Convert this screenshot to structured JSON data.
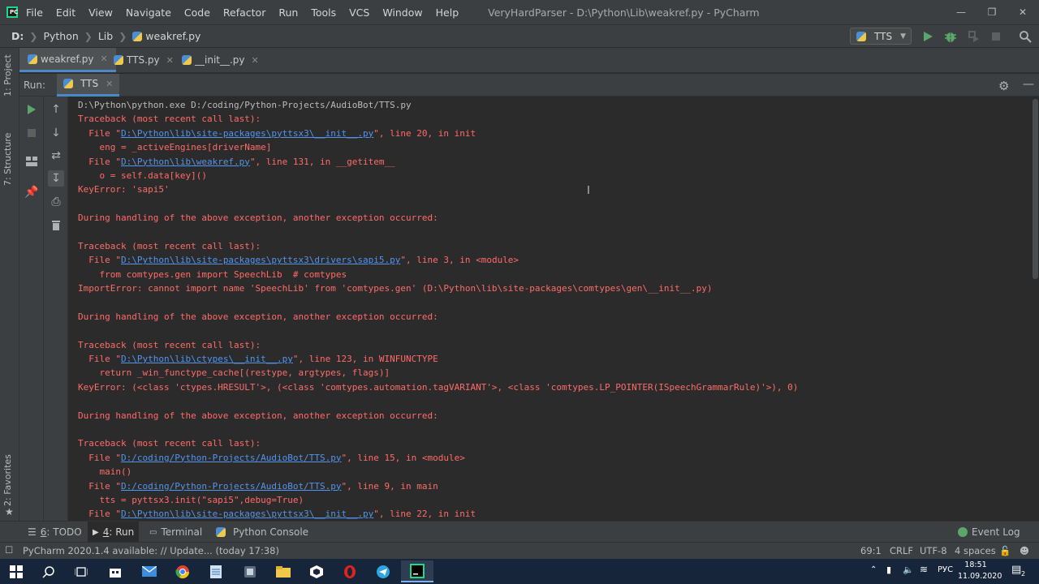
{
  "window": {
    "title": "VeryHardParser - D:\\Python\\Lib\\weakref.py - PyCharm",
    "logo_text": "PC",
    "menu": [
      "File",
      "Edit",
      "View",
      "Navigate",
      "Code",
      "Refactor",
      "Run",
      "Tools",
      "VCS",
      "Window",
      "Help"
    ]
  },
  "breadcrumb": [
    "D:",
    "Python",
    "Lib",
    "weakref.py"
  ],
  "run_config": {
    "name": "TTS"
  },
  "editor_tabs": [
    {
      "label": "weakref.py",
      "active": true
    },
    {
      "label": "TTS.py",
      "active": false
    },
    {
      "label": "__init__.py",
      "active": false
    }
  ],
  "left_stripe": {
    "project": "1: Project",
    "structure": "7: Structure",
    "favorites": "2: Favorites"
  },
  "run_panel": {
    "label": "Run:",
    "tab": "TTS"
  },
  "console": {
    "lines": [
      {
        "type": "cmd",
        "parts": [
          {
            "t": "D:\\Python\\python.exe D:/coding/Python-Projects/AudioBot/TTS.py"
          }
        ]
      },
      {
        "type": "err",
        "parts": [
          {
            "t": "Traceback (most recent call last):"
          }
        ]
      },
      {
        "type": "err",
        "parts": [
          {
            "t": "  File \""
          },
          {
            "t": "D:\\Python\\lib\\site-packages\\pyttsx3\\__init__.py",
            "link": true
          },
          {
            "t": "\", line 20, in init"
          }
        ]
      },
      {
        "type": "err",
        "parts": [
          {
            "t": "    eng = _activeEngines[driverName]"
          }
        ]
      },
      {
        "type": "err",
        "parts": [
          {
            "t": "  File \""
          },
          {
            "t": "D:\\Python\\lib\\weakref.py",
            "link": true
          },
          {
            "t": "\", line 131, in __getitem__"
          }
        ]
      },
      {
        "type": "err",
        "parts": [
          {
            "t": "    o = self.data[key]()"
          }
        ]
      },
      {
        "type": "err",
        "parts": [
          {
            "t": "KeyError: 'sapi5'"
          }
        ]
      },
      {
        "type": "err",
        "parts": [
          {
            "t": ""
          }
        ]
      },
      {
        "type": "err",
        "parts": [
          {
            "t": "During handling of the above exception, another exception occurred:"
          }
        ]
      },
      {
        "type": "err",
        "parts": [
          {
            "t": ""
          }
        ]
      },
      {
        "type": "err",
        "parts": [
          {
            "t": "Traceback (most recent call last):"
          }
        ]
      },
      {
        "type": "err",
        "parts": [
          {
            "t": "  File \""
          },
          {
            "t": "D:\\Python\\lib\\site-packages\\pyttsx3\\drivers\\sapi5.py",
            "link": true
          },
          {
            "t": "\", line 3, in <module>"
          }
        ]
      },
      {
        "type": "err",
        "parts": [
          {
            "t": "    from comtypes.gen import SpeechLib  # comtypes"
          }
        ]
      },
      {
        "type": "err",
        "parts": [
          {
            "t": "ImportError: cannot import name 'SpeechLib' from 'comtypes.gen' (D:\\Python\\lib\\site-packages\\comtypes\\gen\\__init__.py)"
          }
        ]
      },
      {
        "type": "err",
        "parts": [
          {
            "t": ""
          }
        ]
      },
      {
        "type": "err",
        "parts": [
          {
            "t": "During handling of the above exception, another exception occurred:"
          }
        ]
      },
      {
        "type": "err",
        "parts": [
          {
            "t": ""
          }
        ]
      },
      {
        "type": "err",
        "parts": [
          {
            "t": "Traceback (most recent call last):"
          }
        ]
      },
      {
        "type": "err",
        "parts": [
          {
            "t": "  File \""
          },
          {
            "t": "D:\\Python\\lib\\ctypes\\__init__.py",
            "link": true
          },
          {
            "t": "\", line 123, in WINFUNCTYPE"
          }
        ]
      },
      {
        "type": "err",
        "parts": [
          {
            "t": "    return _win_functype_cache[(restype, argtypes, flags)]"
          }
        ]
      },
      {
        "type": "err",
        "parts": [
          {
            "t": "KeyError: (<class 'ctypes.HRESULT'>, (<class 'comtypes.automation.tagVARIANT'>, <class 'comtypes.LP_POINTER(ISpeechGrammarRule)'>), 0)"
          }
        ]
      },
      {
        "type": "err",
        "parts": [
          {
            "t": ""
          }
        ]
      },
      {
        "type": "err",
        "parts": [
          {
            "t": "During handling of the above exception, another exception occurred:"
          }
        ]
      },
      {
        "type": "err",
        "parts": [
          {
            "t": ""
          }
        ]
      },
      {
        "type": "err",
        "parts": [
          {
            "t": "Traceback (most recent call last):"
          }
        ]
      },
      {
        "type": "err",
        "parts": [
          {
            "t": "  File \""
          },
          {
            "t": "D:/coding/Python-Projects/AudioBot/TTS.py",
            "link": true
          },
          {
            "t": "\", line 15, in <module>"
          }
        ]
      },
      {
        "type": "err",
        "parts": [
          {
            "t": "    main()"
          }
        ]
      },
      {
        "type": "err",
        "parts": [
          {
            "t": "  File \""
          },
          {
            "t": "D:/coding/Python-Projects/AudioBot/TTS.py",
            "link": true
          },
          {
            "t": "\", line 9, in main"
          }
        ]
      },
      {
        "type": "err",
        "parts": [
          {
            "t": "    tts = pyttsx3.init(\"sapi5\",debug=True)"
          }
        ]
      },
      {
        "type": "err",
        "parts": [
          {
            "t": "  File \""
          },
          {
            "t": "D:\\Python\\lib\\site-packages\\pyttsx3\\__init__.py",
            "link": true
          },
          {
            "t": "\", line 22, in init"
          }
        ]
      }
    ]
  },
  "bottom_tabs": [
    {
      "key": "6",
      "label": ": TODO",
      "icon": "list-icon"
    },
    {
      "key": "4",
      "label": ": Run",
      "icon": "play-icon",
      "active": true
    },
    {
      "label": "Terminal",
      "icon": "terminal-icon"
    },
    {
      "label": "Python Console",
      "icon": "python-icon"
    },
    {
      "label": "Event Log",
      "icon": "event-log-icon"
    }
  ],
  "status_bar": {
    "message": "PyCharm 2020.1.4 available: // Update... (today 17:38)",
    "position": "69:1",
    "line_sep": "CRLF",
    "encoding": "UTF-8",
    "indent": "4 spaces"
  },
  "taskbar": {
    "language": "РУС",
    "time": "18:51",
    "date": "11.09.2020",
    "notification_count": "2"
  },
  "colors": {
    "error_text": "#ff6b68",
    "link": "#5394ec",
    "run_green": "#59a869",
    "accent": "#4a88c7"
  }
}
